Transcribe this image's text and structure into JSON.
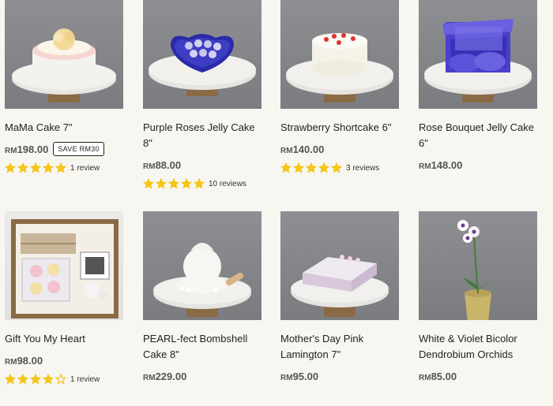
{
  "colors": {
    "star": "#f5c518",
    "background": "#f7f6f1"
  },
  "products": [
    {
      "title": "MaMa Cake 7\"",
      "currency": "RM",
      "amount": "198.00",
      "badge": "SAVE RM30",
      "rating": 5,
      "reviews": "1 review",
      "image_icon": "cake-on-stand-icon"
    },
    {
      "title": "Purple Roses Jelly Cake 8\"",
      "currency": "RM",
      "amount": "88.00",
      "badge": null,
      "rating": 5,
      "reviews": "10 reviews",
      "image_icon": "heart-jelly-cake-icon"
    },
    {
      "title": "Strawberry Shortcake 6\"",
      "currency": "RM",
      "amount": "140.00",
      "badge": null,
      "rating": 5,
      "reviews": "3 reviews",
      "image_icon": "strawberry-cake-icon"
    },
    {
      "title": "Rose Bouquet Jelly Cake 6\"",
      "currency": "RM",
      "amount": "148.00",
      "badge": null,
      "rating": null,
      "reviews": null,
      "image_icon": "bouquet-cake-icon"
    },
    {
      "title": "Gift You My Heart",
      "currency": "RM",
      "amount": "98.00",
      "badge": null,
      "rating": 4,
      "reviews": "1 review",
      "image_icon": "gift-box-icon"
    },
    {
      "title": "PEARL-fect Bombshell Cake 8\"",
      "currency": "RM",
      "amount": "229.00",
      "badge": null,
      "rating": null,
      "reviews": null,
      "image_icon": "pearl-bombshell-icon"
    },
    {
      "title": "Mother's Day Pink Lamington 7\"",
      "currency": "RM",
      "amount": "95.00",
      "badge": null,
      "rating": null,
      "reviews": null,
      "image_icon": "lamington-cake-icon"
    },
    {
      "title": "White & Violet Bicolor Dendrobium Orchids",
      "currency": "RM",
      "amount": "85.00",
      "badge": null,
      "rating": null,
      "reviews": null,
      "image_icon": "orchid-pot-icon"
    }
  ]
}
